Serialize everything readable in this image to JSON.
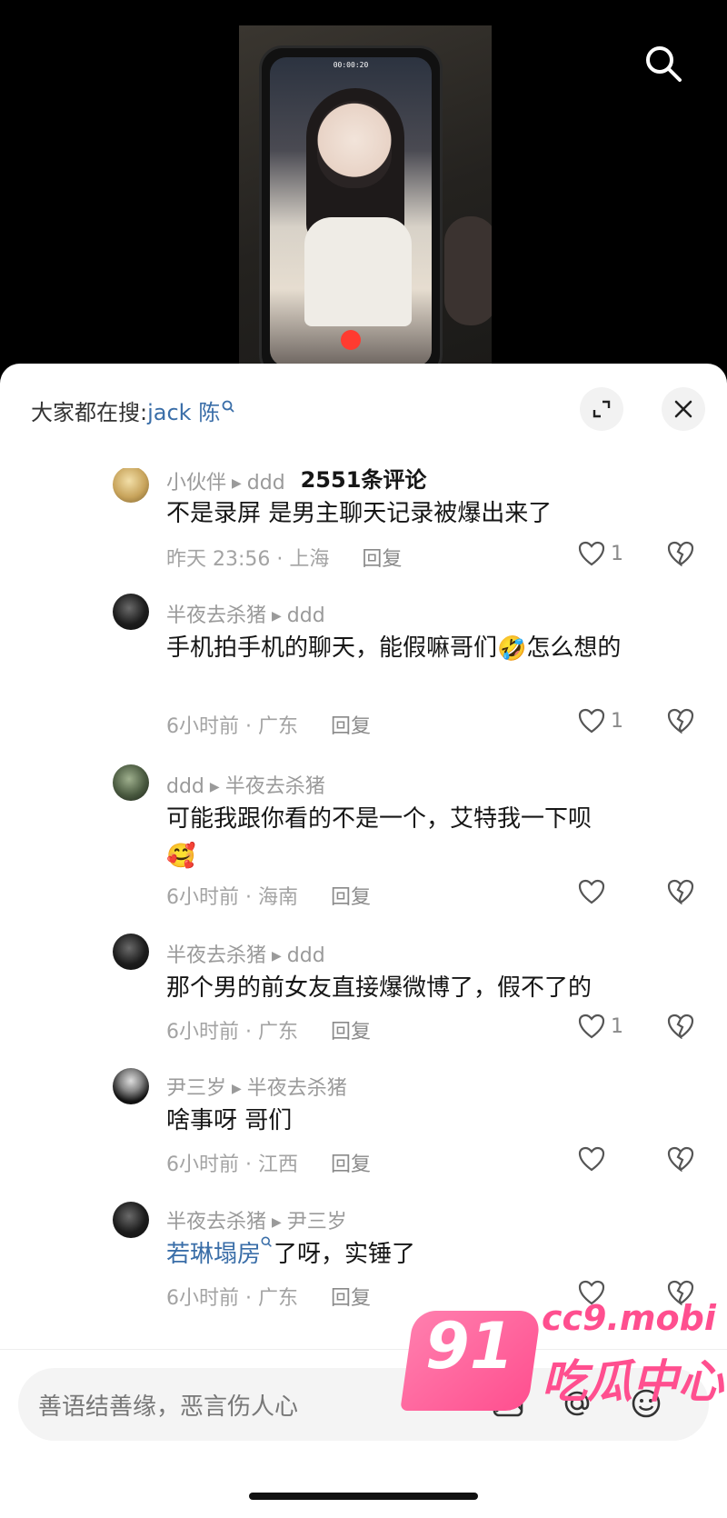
{
  "video": {
    "recording_time": "00:00:20"
  },
  "header": {
    "suggest_prefix": "大家都在搜:",
    "suggest_keyword": "jack 陈",
    "comment_count": "2551条评论"
  },
  "comments": [
    {
      "username": "小伙伴",
      "reply_to": "ddd",
      "text": "不是录屏 是男主聊天记录被爆出来了",
      "time_location": "昨天 23:56 · 上海",
      "reply_label": "回复",
      "likes": "1",
      "avatar": "gold"
    },
    {
      "username": "半夜去杀猪",
      "reply_to": "ddd",
      "text": "手机拍手机的聊天，能假嘛哥们",
      "emoji": "🤣",
      "text_after": "怎么想的",
      "time_location": "6小时前 · 广东",
      "reply_label": "回复",
      "likes": "1",
      "avatar": "dark"
    },
    {
      "username": "ddd",
      "reply_to": "半夜去杀猪",
      "text": "可能我跟你看的不是一个，艾特我一下呗",
      "emoji": "🥰",
      "time_location": "6小时前 · 海南",
      "reply_label": "回复",
      "likes": "",
      "avatar": "green"
    },
    {
      "username": "半夜去杀猪",
      "reply_to": "ddd",
      "text": "那个男的前女友直接爆微博了，假不了的",
      "time_location": "6小时前 · 广东",
      "reply_label": "回复",
      "likes": "1",
      "avatar": "dark"
    },
    {
      "username": "尹三岁",
      "reply_to": "半夜去杀猪",
      "text": "啥事呀 哥们",
      "time_location": "6小时前 · 江西",
      "reply_label": "回复",
      "likes": "",
      "avatar": "mono"
    },
    {
      "username": "半夜去杀猪",
      "reply_to": "尹三岁",
      "keyword": "若琳塌房",
      "text": "了呀，实锤了",
      "time_location": "6小时前 · 广东",
      "reply_label": "回复",
      "likes": "",
      "avatar": "dark"
    }
  ],
  "input": {
    "placeholder": "善语结善缘，恶言伤人心"
  },
  "watermark": {
    "number": "91",
    "domain": "cc9.mobi",
    "name": "吃瓜中心"
  },
  "colors": {
    "link_blue": "#3a6ea8",
    "watermark_pink": "#ff4f8f"
  },
  "icons": [
    "search-icon",
    "expand-icon",
    "close-icon",
    "heart-icon",
    "broken-heart-icon",
    "image-icon",
    "at-icon",
    "emoji-icon",
    "play-arrow-icon"
  ]
}
